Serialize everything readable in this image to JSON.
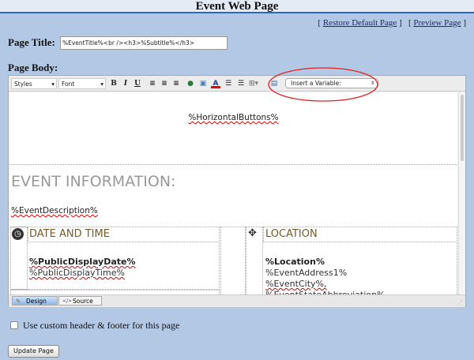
{
  "header": {
    "title": "Event Web Page"
  },
  "links": {
    "restore": "Restore Default Page",
    "preview": "Preview Page"
  },
  "page_title": {
    "label": "Page Title:",
    "value": "%EventTitle%<br /><h3>%Subtitle%</h3>"
  },
  "page_body": {
    "label": "Page Body:"
  },
  "toolbar": {
    "styles": "Styles",
    "font": "Font",
    "bold": "B",
    "italic": "I",
    "underline": "U",
    "insert_variable": "Insert a Variable:",
    "font_color": "A"
  },
  "content": {
    "horizontal_buttons": "%HorizontalButtons%",
    "heading": "EVENT INFORMATION:",
    "description": "%EventDescription%",
    "date_heading": "DATE AND TIME",
    "date": "%PublicDisplayDate%",
    "time": "%PublicDisplayTime%",
    "location_heading": "LOCATION",
    "location": "%Location%",
    "address": "%EventAddress1%",
    "city": "%EventCity%,",
    "state": "%EventStateAbbreviation%"
  },
  "tabs": {
    "design": "Design",
    "source": "Source"
  },
  "custom_header": {
    "label": "Use custom header & footer for this page",
    "checked": false
  },
  "update_button": "Update Page",
  "colors": {
    "background": "#b3c8e4",
    "heading_brown": "#7a5a2a",
    "annotation_circle": "#e02020"
  }
}
